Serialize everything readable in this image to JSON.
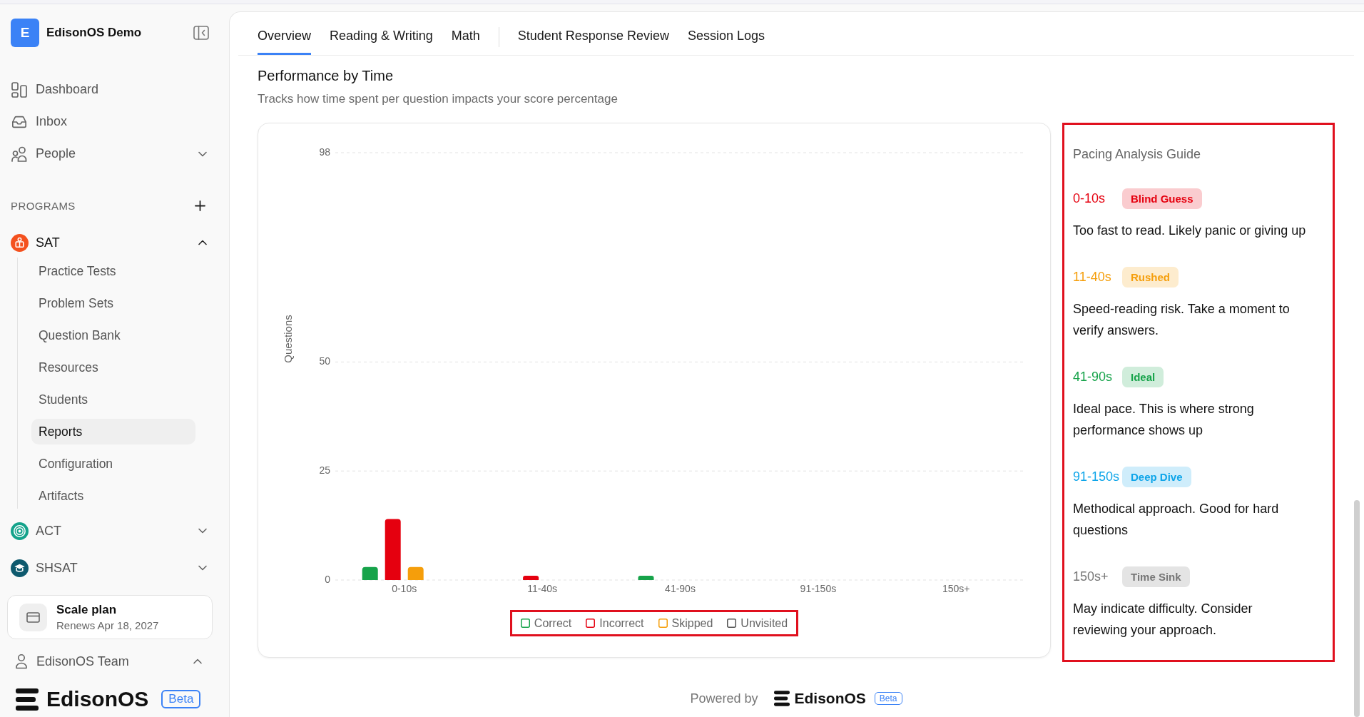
{
  "sidebar": {
    "workspace": {
      "initial": "E",
      "name": "EdisonOS Demo"
    },
    "nav": [
      {
        "label": "Dashboard",
        "selected": false
      },
      {
        "label": "Inbox",
        "selected": false
      },
      {
        "label": "People",
        "selected": false,
        "expanded": false
      }
    ],
    "programs": {
      "label": "PROGRAMS",
      "items": [
        {
          "name": "SAT",
          "color": "#f4511e",
          "expanded": true,
          "children": [
            {
              "label": "Practice Tests",
              "selected": false
            },
            {
              "label": "Problem Sets",
              "selected": false
            },
            {
              "label": "Question Bank",
              "selected": false
            },
            {
              "label": "Resources",
              "selected": false
            },
            {
              "label": "Students",
              "selected": false
            },
            {
              "label": "Reports",
              "selected": true
            },
            {
              "label": "Configuration",
              "selected": false
            },
            {
              "label": "Artifacts",
              "selected": false
            }
          ]
        },
        {
          "name": "ACT",
          "color": "#14a38b",
          "expanded": false
        },
        {
          "name": "SHSAT",
          "color": "#0e5a6e",
          "expanded": false
        }
      ]
    },
    "plan": {
      "name": "Scale plan",
      "renewal": "Renews Apr 18, 2027"
    },
    "team": {
      "name": "EdisonOS Team",
      "expanded": true
    },
    "brand": {
      "name": "EdisonOS",
      "badge": "Beta"
    }
  },
  "main": {
    "tab_groups": [
      {
        "tabs": [
          {
            "label": "Overview",
            "selected": true
          },
          {
            "label": "Reading & Writing",
            "selected": false
          },
          {
            "label": "Math",
            "selected": false
          }
        ]
      },
      {
        "tabs": [
          {
            "label": "Student Response Review",
            "selected": false
          },
          {
            "label": "Session Logs",
            "selected": false
          }
        ]
      }
    ],
    "section": {
      "title": "Performance by Time",
      "subtitle": "Tracks how time spent per question impacts your score percentage"
    },
    "chart": {
      "legend_highlighted": true,
      "chart_data": {
        "type": "bar",
        "ylabel": "Questions",
        "categories": [
          "0-10s",
          "11-40s",
          "41-90s",
          "91-150s",
          "150s+"
        ],
        "series": [
          {
            "name": "Correct",
            "color": "#16a34a",
            "values": [
              3,
              0,
              1,
              0,
              0
            ]
          },
          {
            "name": "Incorrect",
            "color": "#e5000f",
            "values": [
              14,
              1,
              0,
              0,
              0
            ]
          },
          {
            "name": "Skipped",
            "color": "#f59e0b",
            "values": [
              3,
              0,
              0,
              0,
              0
            ]
          },
          {
            "name": "Unvisited",
            "color": "#555555",
            "values": [
              0,
              0,
              0,
              0,
              0
            ]
          }
        ],
        "ylim": [
          0,
          98
        ],
        "yticks": [
          0,
          25,
          50,
          98
        ],
        "legend": "bottom"
      }
    },
    "guide": {
      "title": "Pacing Analysis Guide",
      "highlighted": true,
      "items": [
        {
          "range": "0-10s",
          "badge": "Blind Guess",
          "color": "#e5000f",
          "description": "Too fast to read. Likely panic or giving up"
        },
        {
          "range": "11-40s",
          "badge": "Rushed",
          "color": "#f59e0b",
          "description": "Speed-reading risk. Take a moment to verify answers."
        },
        {
          "range": "41-90s",
          "badge": "Ideal",
          "color": "#16a34a",
          "description": "Ideal pace. This is where strong performance shows up"
        },
        {
          "range": "91-150s",
          "badge": "Deep Dive",
          "color": "#0ea5e9",
          "description": "Methodical approach. Good for hard questions"
        },
        {
          "range": "150s+",
          "badge": "Time Sink",
          "color": "#777777",
          "description": "May indicate difficulty. Consider reviewing your approach."
        }
      ]
    },
    "footer": {
      "powered_by": "Powered by",
      "brand": "EdisonOS",
      "badge": "Beta"
    }
  }
}
